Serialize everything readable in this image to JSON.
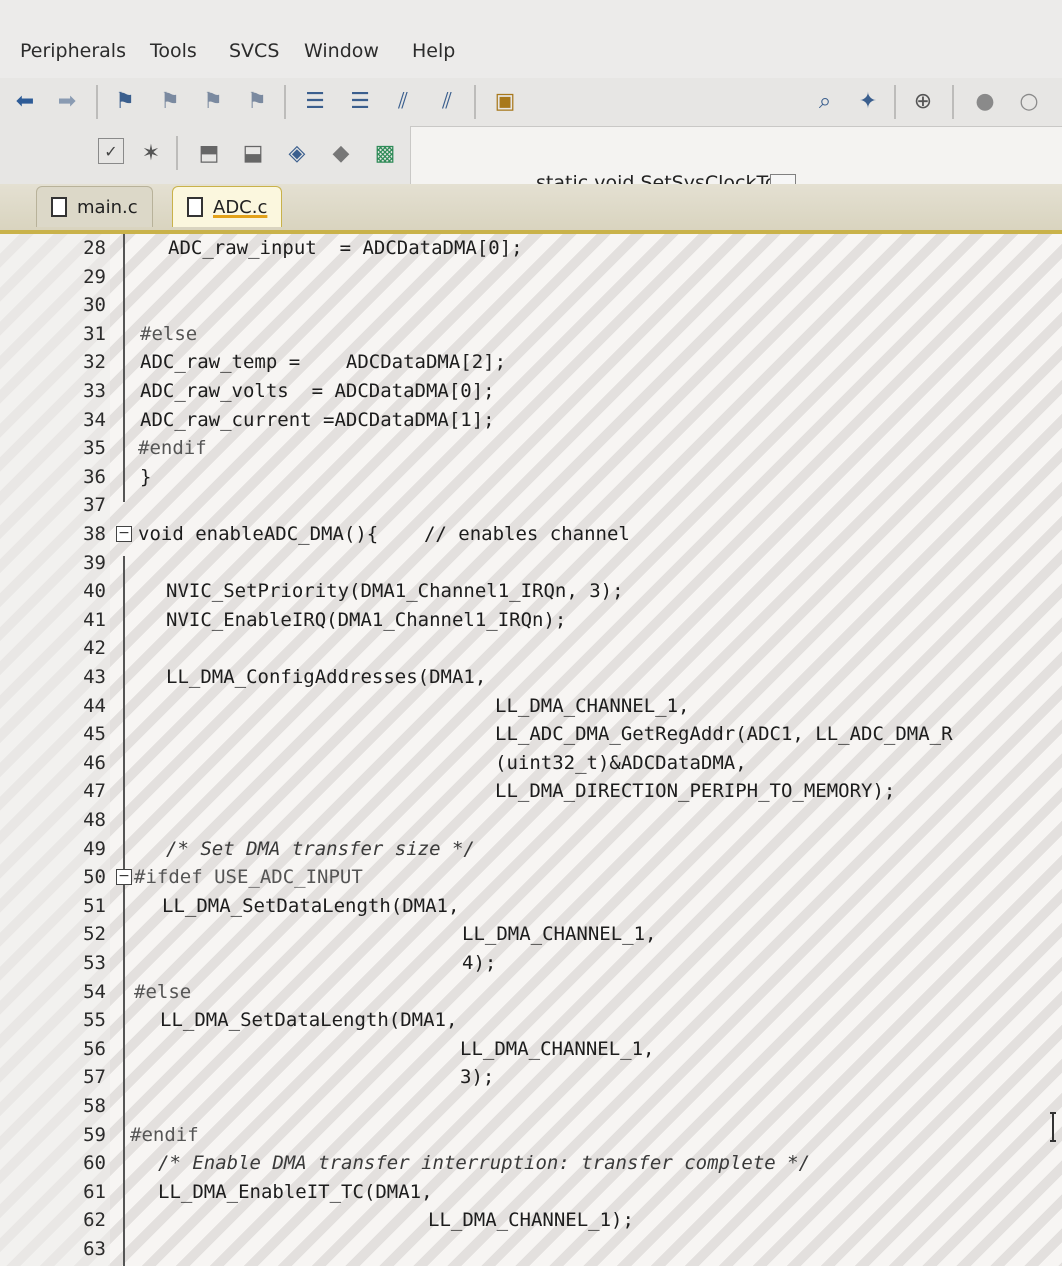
{
  "menu": [
    "Peripherals",
    "Tools",
    "SVCS",
    "Window",
    "Help"
  ],
  "toolbar": {
    "function_combo": "static void SetSysClockTo",
    "combo_arrow": "⌵"
  },
  "tabs": [
    {
      "label": "main.c",
      "active": false
    },
    {
      "label": "ADC.c",
      "active": true
    }
  ],
  "code_lines": [
    {
      "n": "28",
      "text": "ADC_raw_input  = ADCDataDMA[0];"
    },
    {
      "n": "29",
      "text": ""
    },
    {
      "n": "30",
      "text": ""
    },
    {
      "n": "31",
      "text": "#else"
    },
    {
      "n": "32",
      "text": "ADC_raw_temp =    ADCDataDMA[2];"
    },
    {
      "n": "33",
      "text": "ADC_raw_volts  = ADCDataDMA[0];"
    },
    {
      "n": "34",
      "text": "ADC_raw_current =ADCDataDMA[1];"
    },
    {
      "n": "35",
      "text": "#endif"
    },
    {
      "n": "36",
      "text": "}"
    },
    {
      "n": "37",
      "text": ""
    },
    {
      "n": "38",
      "text": "void enableADC_DMA(){    // enables channel"
    },
    {
      "n": "39",
      "text": ""
    },
    {
      "n": "40",
      "text": "NVIC_SetPriority(DMA1_Channel1_IRQn, 3);"
    },
    {
      "n": "41",
      "text": "NVIC_EnableIRQ(DMA1_Channel1_IRQn);"
    },
    {
      "n": "42",
      "text": ""
    },
    {
      "n": "43",
      "text": "LL_DMA_ConfigAddresses(DMA1,"
    },
    {
      "n": "44",
      "text": "LL_DMA_CHANNEL_1,"
    },
    {
      "n": "45",
      "text": "LL_ADC_DMA_GetRegAddr(ADC1, LL_ADC_DMA_R"
    },
    {
      "n": "46",
      "text": "(uint32_t)&ADCDataDMA,"
    },
    {
      "n": "47",
      "text": "LL_DMA_DIRECTION_PERIPH_TO_MEMORY);"
    },
    {
      "n": "48",
      "text": ""
    },
    {
      "n": "49",
      "text": "/* Set DMA transfer size */"
    },
    {
      "n": "50",
      "text": "#ifdef USE_ADC_INPUT"
    },
    {
      "n": "51",
      "text": "LL_DMA_SetDataLength(DMA1,"
    },
    {
      "n": "52",
      "text": "LL_DMA_CHANNEL_1,"
    },
    {
      "n": "53",
      "text": "4);"
    },
    {
      "n": "54",
      "text": "#else"
    },
    {
      "n": "55",
      "text": "LL_DMA_SetDataLength(DMA1,"
    },
    {
      "n": "56",
      "text": "LL_DMA_CHANNEL_1,"
    },
    {
      "n": "57",
      "text": "3);"
    },
    {
      "n": "58",
      "text": ""
    },
    {
      "n": "59",
      "text": "#endif"
    },
    {
      "n": "60",
      "text": "/* Enable DMA transfer interruption: transfer complete */"
    },
    {
      "n": "61",
      "text": "LL_DMA_EnableIT_TC(DMA1,"
    },
    {
      "n": "62",
      "text": "LL_DMA_CHANNEL_1);"
    },
    {
      "n": "63",
      "text": ""
    }
  ],
  "icons": {
    "toolbar1": [
      "back-arrow-icon",
      "forward-arrow-icon",
      "bookmark-icon",
      "prev-bookmark-icon",
      "next-bookmark-icon",
      "clear-bookmarks-icon",
      "indent-icon",
      "unindent-icon",
      "comment-icon",
      "uncomment-icon",
      "find-in-files-icon",
      "find-icon",
      "debug-icon",
      "zoom-icon",
      "breakpoint-icon",
      "breakpoint-disabled-icon"
    ],
    "toolbar2": [
      "checkbox-icon",
      "magic-wand-icon",
      "load-icon",
      "download-icon",
      "target-options-icon",
      "translate-icon",
      "build-all-icon"
    ]
  }
}
